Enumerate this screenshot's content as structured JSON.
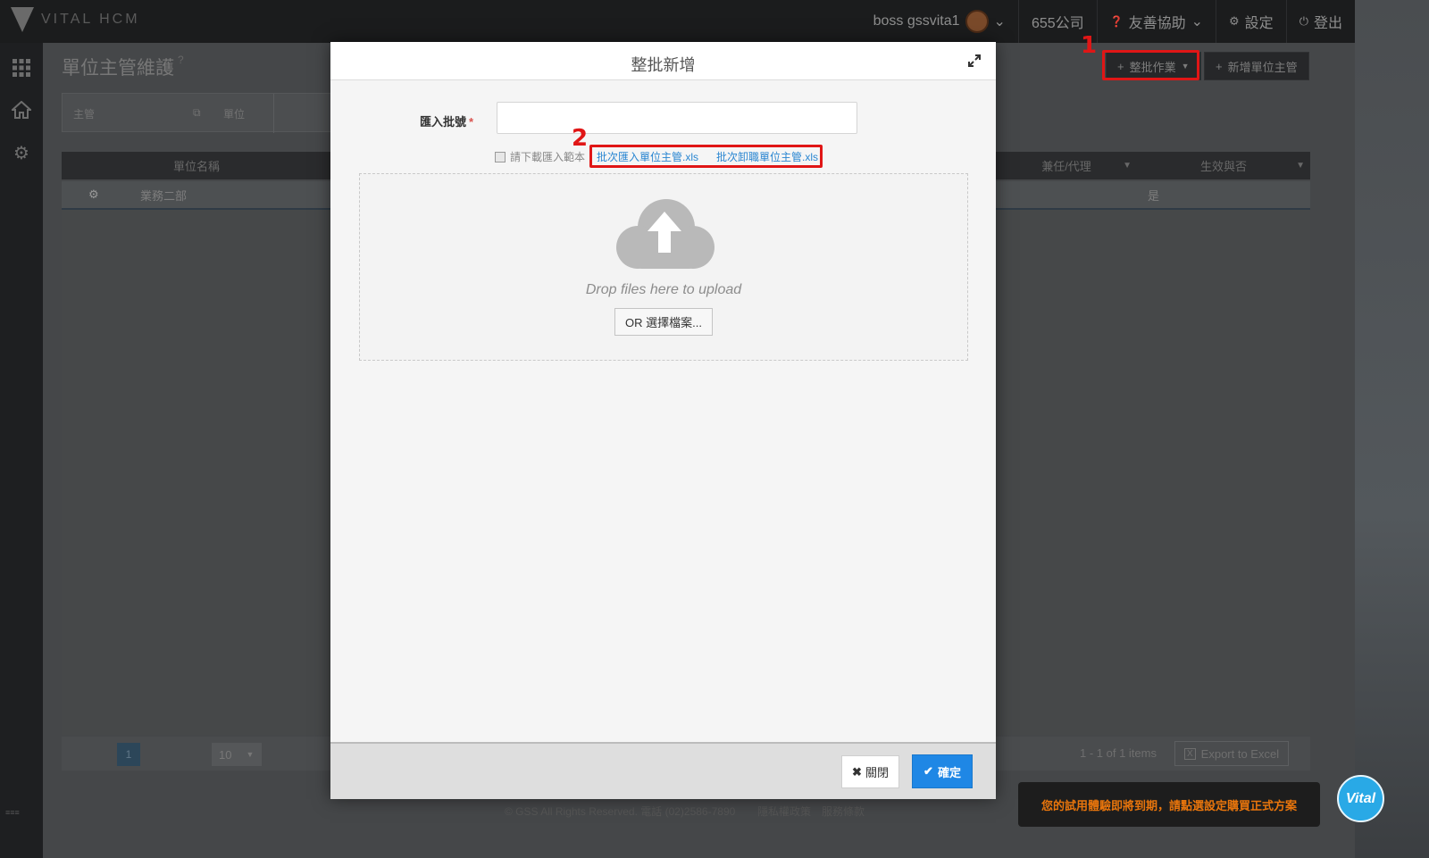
{
  "app": {
    "logo_text": "VITAL HCM",
    "user": "boss gssvita1",
    "company": "655公司",
    "help": "友善協助",
    "settings": "設定",
    "logout": "登出"
  },
  "page": {
    "title": "單位主管維護",
    "batch_button": "整批作業",
    "add_button": "新增單位主管",
    "filter_manager": "主管",
    "filter_unit": "單位"
  },
  "table": {
    "headers": {
      "unit_name": "單位名稱",
      "concurrent": "兼任/代理",
      "effective": "生效與否"
    },
    "row": {
      "unit": "業務二部",
      "effective": "是"
    },
    "page_number": "1",
    "page_size": "10",
    "items_info": "1 - 1 of 1 items",
    "export": "Export to Excel"
  },
  "footer": {
    "copyright": "© GSS All Rights Reserved. 電話 (02)2586-7890",
    "privacy": "隱私權政策",
    "terms": "服務條款"
  },
  "toast": "您的試用體驗即將到期，請點選設定購買正式方案",
  "bubble": "Vital",
  "annotations": {
    "one": "1",
    "two": "2"
  },
  "modal": {
    "title": "整批新增",
    "batch_label": "匯入批號",
    "required_mark": "*",
    "batch_value": "",
    "hint": "請下載匯入範本",
    "link_import": "批次匯入單位主管.xls",
    "link_resign": "批次卸職單位主管.xls",
    "drop_text": "Drop files here to upload",
    "choose_file": "OR 選擇檔案...",
    "close": "關閉",
    "confirm": "確定"
  },
  "colors": {
    "accent": "#1f87e5",
    "annotation": "#e01616",
    "toast_text": "#e8750c"
  }
}
